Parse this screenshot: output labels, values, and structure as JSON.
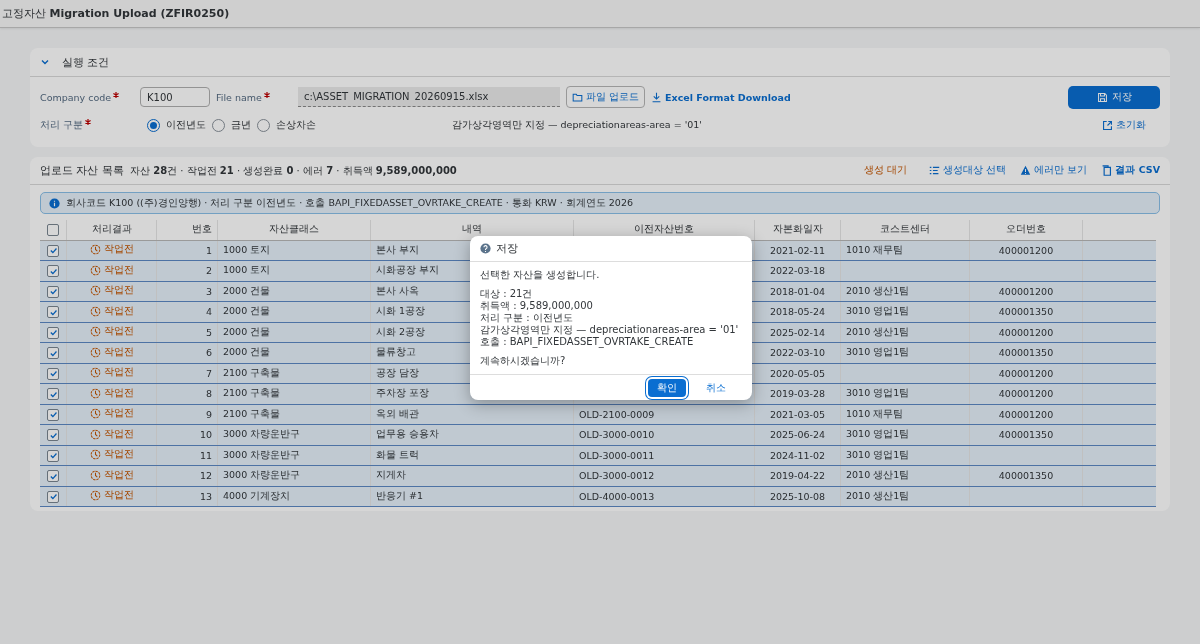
{
  "header": {
    "title_prefix": "고정자산",
    "title": "Migration Upload (ZFIR0250)"
  },
  "criteria": {
    "title": "실행 조건",
    "expanded": true,
    "company_code": {
      "label": "Company code",
      "required": true,
      "value": "K100"
    },
    "file_name": {
      "label": "File name",
      "required": true,
      "value": "c:\\ASSET_MIGRATION_20260915.xlsx"
    },
    "upload_button": "파일 업로드",
    "download_link": "Excel Format Download",
    "save_button": "저장",
    "mode": {
      "label": "처리 구분",
      "required": true,
      "options": [
        {
          "label": "이전년도",
          "selected": true
        },
        {
          "label": "금년",
          "selected": false
        },
        {
          "label": "손상차손",
          "selected": false
        }
      ]
    },
    "note": "감가상각영역만 지정 — depreciationareas-area = '01'",
    "reset_link": "초기화"
  },
  "list": {
    "title": "업로드 자산 목록",
    "summary": "자산 **28**건 · 작업전 **21** · 생성완료 **0** · 에러 **7** · 취득액 **9,589,000,000**",
    "status_text": "생성 대기",
    "actions": [
      {
        "kind": "select",
        "label": "생성대상 선택"
      },
      {
        "kind": "errors",
        "label": "에러만 보기"
      },
      {
        "kind": "csv",
        "label": "결과 CSV"
      }
    ],
    "info": "회사코드 K100 ((주)경인양행) · 처리 구분 이전년도 · 호출 BAPI_FIXEDASSET_OVRTAKE_CREATE · 통화 KRW · 회계연도 2026",
    "all_checked": false,
    "columns": [
      "처리결과",
      "번호",
      "자산클래스",
      "내역",
      "이전자산번호",
      "자본화일자",
      "코스트센터",
      "오더번호"
    ],
    "rows": [
      {
        "selected": true,
        "status": "작업전",
        "no": "1",
        "class": "1000 토지",
        "desc": "본사 부지",
        "date": "2021-02-11",
        "cost_center": "1010 재무팀",
        "order": "400001200"
      },
      {
        "selected": true,
        "status": "작업전",
        "no": "2",
        "class": "1000 토지",
        "desc": "시화공장 부지",
        "date": "2022-03-18"
      },
      {
        "selected": true,
        "status": "작업전",
        "no": "3",
        "class": "2000 건물",
        "desc": "본사 사옥",
        "date": "2018-01-04",
        "cost_center": "2010 생산1팀",
        "order": "400001200"
      },
      {
        "selected": true,
        "status": "작업전",
        "no": "4",
        "class": "2000 건물",
        "desc": "시화 1공장",
        "date": "2018-05-24",
        "cost_center": "3010 영업1팀",
        "order": "400001350"
      },
      {
        "selected": true,
        "status": "작업전",
        "no": "5",
        "class": "2000 건물",
        "desc": "시화 2공장",
        "date": "2025-02-14",
        "cost_center": "2010 생산1팀",
        "order": "400001200"
      },
      {
        "selected": true,
        "status": "작업전",
        "no": "6",
        "class": "2000 건물",
        "desc": "물류창고",
        "date": "2022-03-10",
        "cost_center": "3010 영업1팀",
        "order": "400001350"
      },
      {
        "selected": true,
        "status": "작업전",
        "no": "7",
        "class": "2100 구축물",
        "desc": "공장 담장",
        "date": "2020-05-05",
        "order": "400001200"
      },
      {
        "selected": true,
        "status": "작업전",
        "no": "8",
        "class": "2100 구축물",
        "desc": "주차장 포장",
        "date": "2019-03-28",
        "cost_center": "3010 영업1팀",
        "order": "400001200"
      },
      {
        "selected": true,
        "status": "작업전",
        "no": "9",
        "class": "2100 구축물",
        "desc": "옥외 배관",
        "old_no": "OLD-2100-0009",
        "date": "2021-03-05",
        "cost_center": "1010 재무팀",
        "order": "400001200"
      },
      {
        "selected": true,
        "status": "작업전",
        "no": "10",
        "class": "3000 차량운반구",
        "desc": "업무용 승용차",
        "old_no": "OLD-3000-0010",
        "date": "2025-06-24",
        "cost_center": "3010 영업1팀",
        "order": "400001350"
      },
      {
        "selected": true,
        "status": "작업전",
        "no": "11",
        "class": "3000 차량운반구",
        "desc": "화물 트럭",
        "old_no": "OLD-3000-0011",
        "date": "2024-11-02",
        "cost_center": "3010 영업1팀"
      },
      {
        "selected": true,
        "status": "작업전",
        "no": "12",
        "class": "3000 차량운반구",
        "desc": "지게차",
        "old_no": "OLD-3000-0012",
        "date": "2019-04-22",
        "cost_center": "2010 생산1팀",
        "order": "400001350"
      },
      {
        "selected": true,
        "status": "작업전",
        "no": "13",
        "class": "4000 기계장치",
        "desc": "반응기 #1",
        "old_no": "OLD-4000-0013",
        "date": "2025-10-08",
        "cost_center": "2010 생산1팀"
      }
    ]
  },
  "dialog": {
    "title": "저장",
    "paragraphs": [
      [
        "선택한 자산을 생성합니다."
      ],
      [
        "대상 : 21건",
        "취득액 : 9,589,000,000",
        "처리 구분 : 이전년도",
        "감가상각영역만 지정 — depreciationareas-area = '01'",
        "호출 : BAPI_FIXEDASSET_OVRTAKE_CREATE"
      ],
      [
        "계속하시겠습니까?"
      ]
    ],
    "ok": "확인",
    "cancel": "취소"
  }
}
